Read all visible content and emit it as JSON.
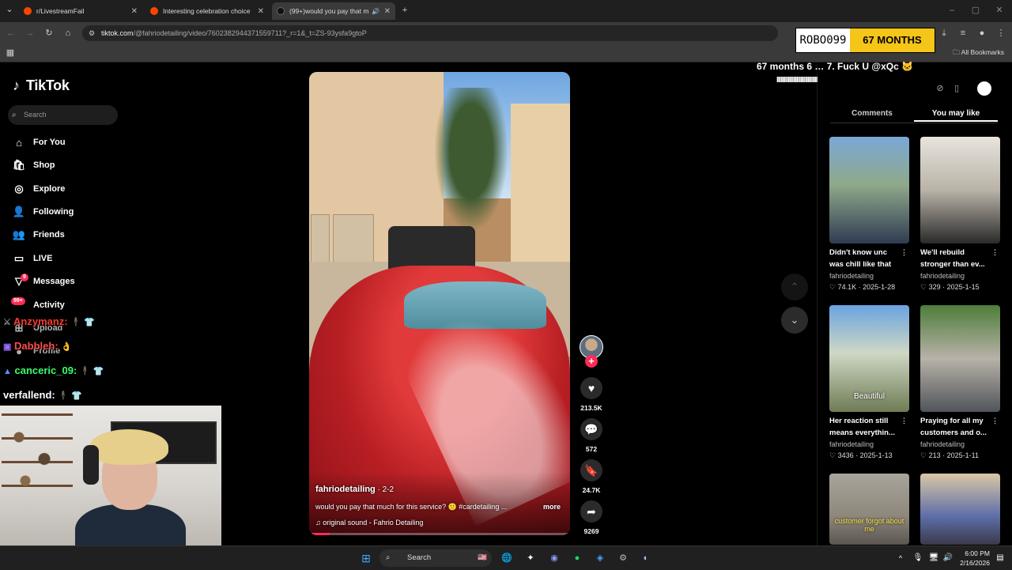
{
  "browser": {
    "tabs": [
      {
        "title": "r/LivestreamFail",
        "active": false
      },
      {
        "title": "Interesting celebration choice b",
        "active": false
      },
      {
        "title": "(99+)would you pay that m",
        "active": true
      }
    ],
    "url_host": "tiktok.com",
    "url_path": "/@fahriodetailing/video/7602382944371559711?_r=1&_t=ZS-93ysfa9gtoP",
    "all_bookmarks": "All Bookmarks"
  },
  "tiktok": {
    "logo": "TikTok",
    "search_placeholder": "Search",
    "nav": [
      {
        "label": "For You",
        "icon": "home-icon"
      },
      {
        "label": "Shop",
        "icon": "shop-icon"
      },
      {
        "label": "Explore",
        "icon": "compass-icon"
      },
      {
        "label": "Following",
        "icon": "following-icon"
      },
      {
        "label": "Friends",
        "icon": "friends-icon"
      },
      {
        "label": "LIVE",
        "icon": "live-icon"
      },
      {
        "label": "Messages",
        "icon": "messages-icon"
      },
      {
        "label": "Activity",
        "icon": "activity-icon"
      },
      {
        "label": "Upload",
        "icon": "upload-icon"
      },
      {
        "label": "Profile",
        "icon": "profile-icon"
      }
    ],
    "activity_badge": "99+",
    "messages_badge": "9",
    "video": {
      "author": "fahriodetailing",
      "author_suffix": " · 2-2",
      "caption": "would you pay that much for this service? 🙂 #cardetailing ...",
      "more": "more",
      "sound": "original sound - Fahrio Detailing",
      "progress": 0.08
    },
    "actions": {
      "likes": "213.5K",
      "comments": "572",
      "saves": "24.7K",
      "shares": "9269"
    },
    "panel": {
      "tab_comments": "Comments",
      "tab_you_may_like": "You may like",
      "cards": [
        {
          "title": "Didn't know unc was chill like that",
          "author": "fahriodetailing",
          "stats": "♡ 74.1K · 2025-1-28",
          "overlay": ""
        },
        {
          "title": "We'll rebuild stronger than ev...",
          "author": "fahriodetailing",
          "stats": "♡ 329 · 2025-1-15",
          "overlay": ""
        },
        {
          "title": "Her reaction still means everythin...",
          "author": "fahriodetailing",
          "stats": "♡ 3436 · 2025-1-13",
          "overlay": "Beautiful"
        },
        {
          "title": "Praying for all my customers and o...",
          "author": "fahriodetailing",
          "stats": "♡ 213 · 2025-1-11",
          "overlay": ""
        },
        {
          "title": "",
          "author": "",
          "stats": "",
          "overlay": "customer forgot about me"
        },
        {
          "title": "",
          "author": "",
          "stats": "",
          "overlay": ""
        }
      ]
    }
  },
  "stream_overlay": {
    "sub_name": "ROBO099",
    "sub_months": "67 MONTHS",
    "sub_message": "67 months 6 … 7. Fuck U @xQc",
    "sub_message2": "IIIIIIIIIIIIIIIIIIIIIIIIIIIII",
    "chat": [
      {
        "user": "Anzymanz:",
        "color": "#ff3b30"
      },
      {
        "user": "Dabbleh:",
        "color": "#ff4d4d"
      },
      {
        "user": "canceric_09:",
        "color": "#39ff6a"
      },
      {
        "user": "verfallend:",
        "color": "#ffffff"
      }
    ]
  },
  "taskbar": {
    "search": "Search",
    "time": "6:00 PM",
    "date": "2/16/2026"
  }
}
